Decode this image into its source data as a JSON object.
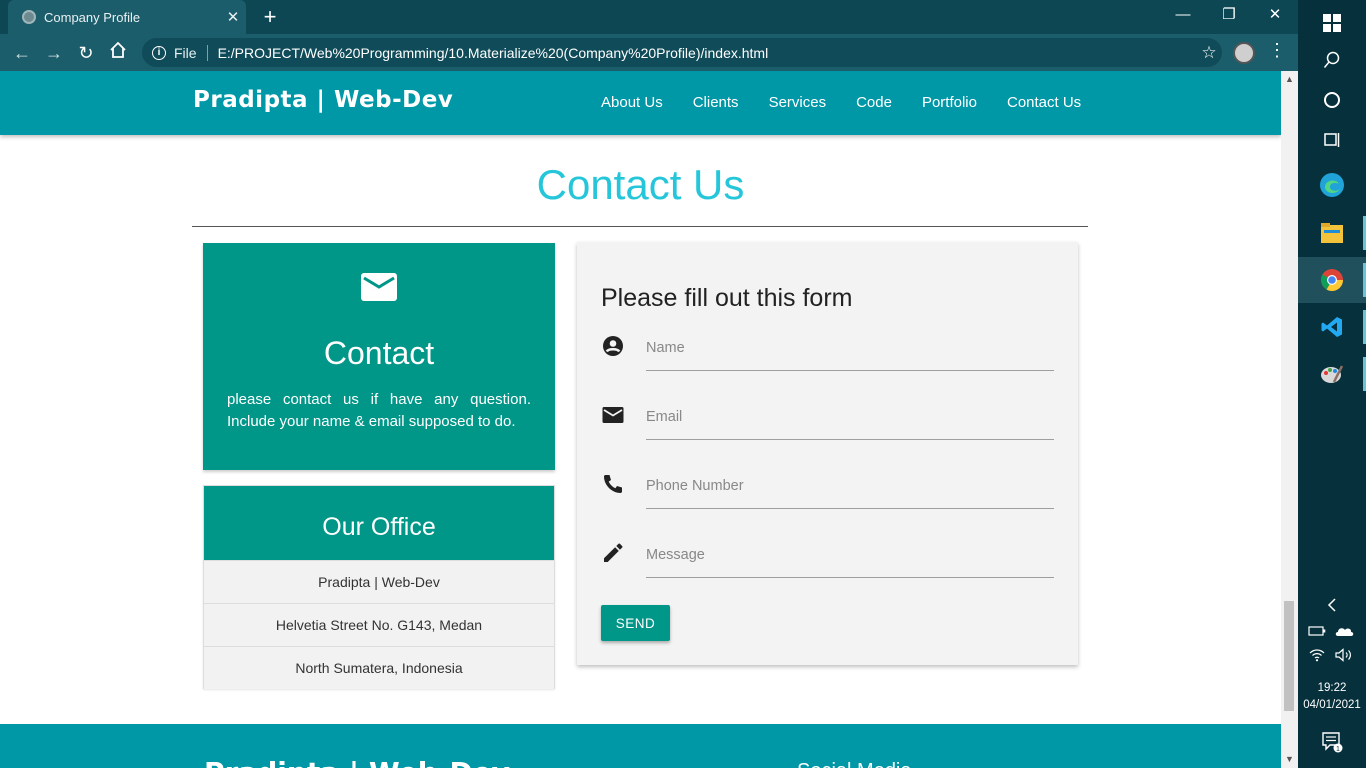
{
  "browser": {
    "tab_title": "Company Profile",
    "protocol_label": "File",
    "url": "E:/PROJECT/Web%20Programming/10.Materialize%20(Company%20Profile)/index.html"
  },
  "navbar": {
    "brand": "Pradipta | Web-Dev",
    "links": [
      "About Us",
      "Clients",
      "Services",
      "Code",
      "Portfolio",
      "Contact Us"
    ]
  },
  "section": {
    "title": "Contact Us"
  },
  "contact_card": {
    "title": "Contact",
    "description": "please contact us if have any question. Include your name & email supposed to do."
  },
  "office": {
    "title": "Our Office",
    "lines": [
      "Pradipta | Web-Dev",
      "Helvetia Street No. G143, Medan",
      "North Sumatera, Indonesia"
    ]
  },
  "form": {
    "title": "Please fill out this form",
    "name_placeholder": "Name",
    "email_placeholder": "Email",
    "phone_placeholder": "Phone Number",
    "message_placeholder": "Message",
    "submit_label": "SEND"
  },
  "footer": {
    "brand": "Pradipta | Web-Dev",
    "social": "Social Media"
  },
  "taskbar": {
    "time": "19:22",
    "date": "04/01/2021",
    "notification_count": "1"
  },
  "colors": {
    "primary": "#0097a7",
    "teal": "#009688",
    "accent_title": "#26c6da"
  }
}
